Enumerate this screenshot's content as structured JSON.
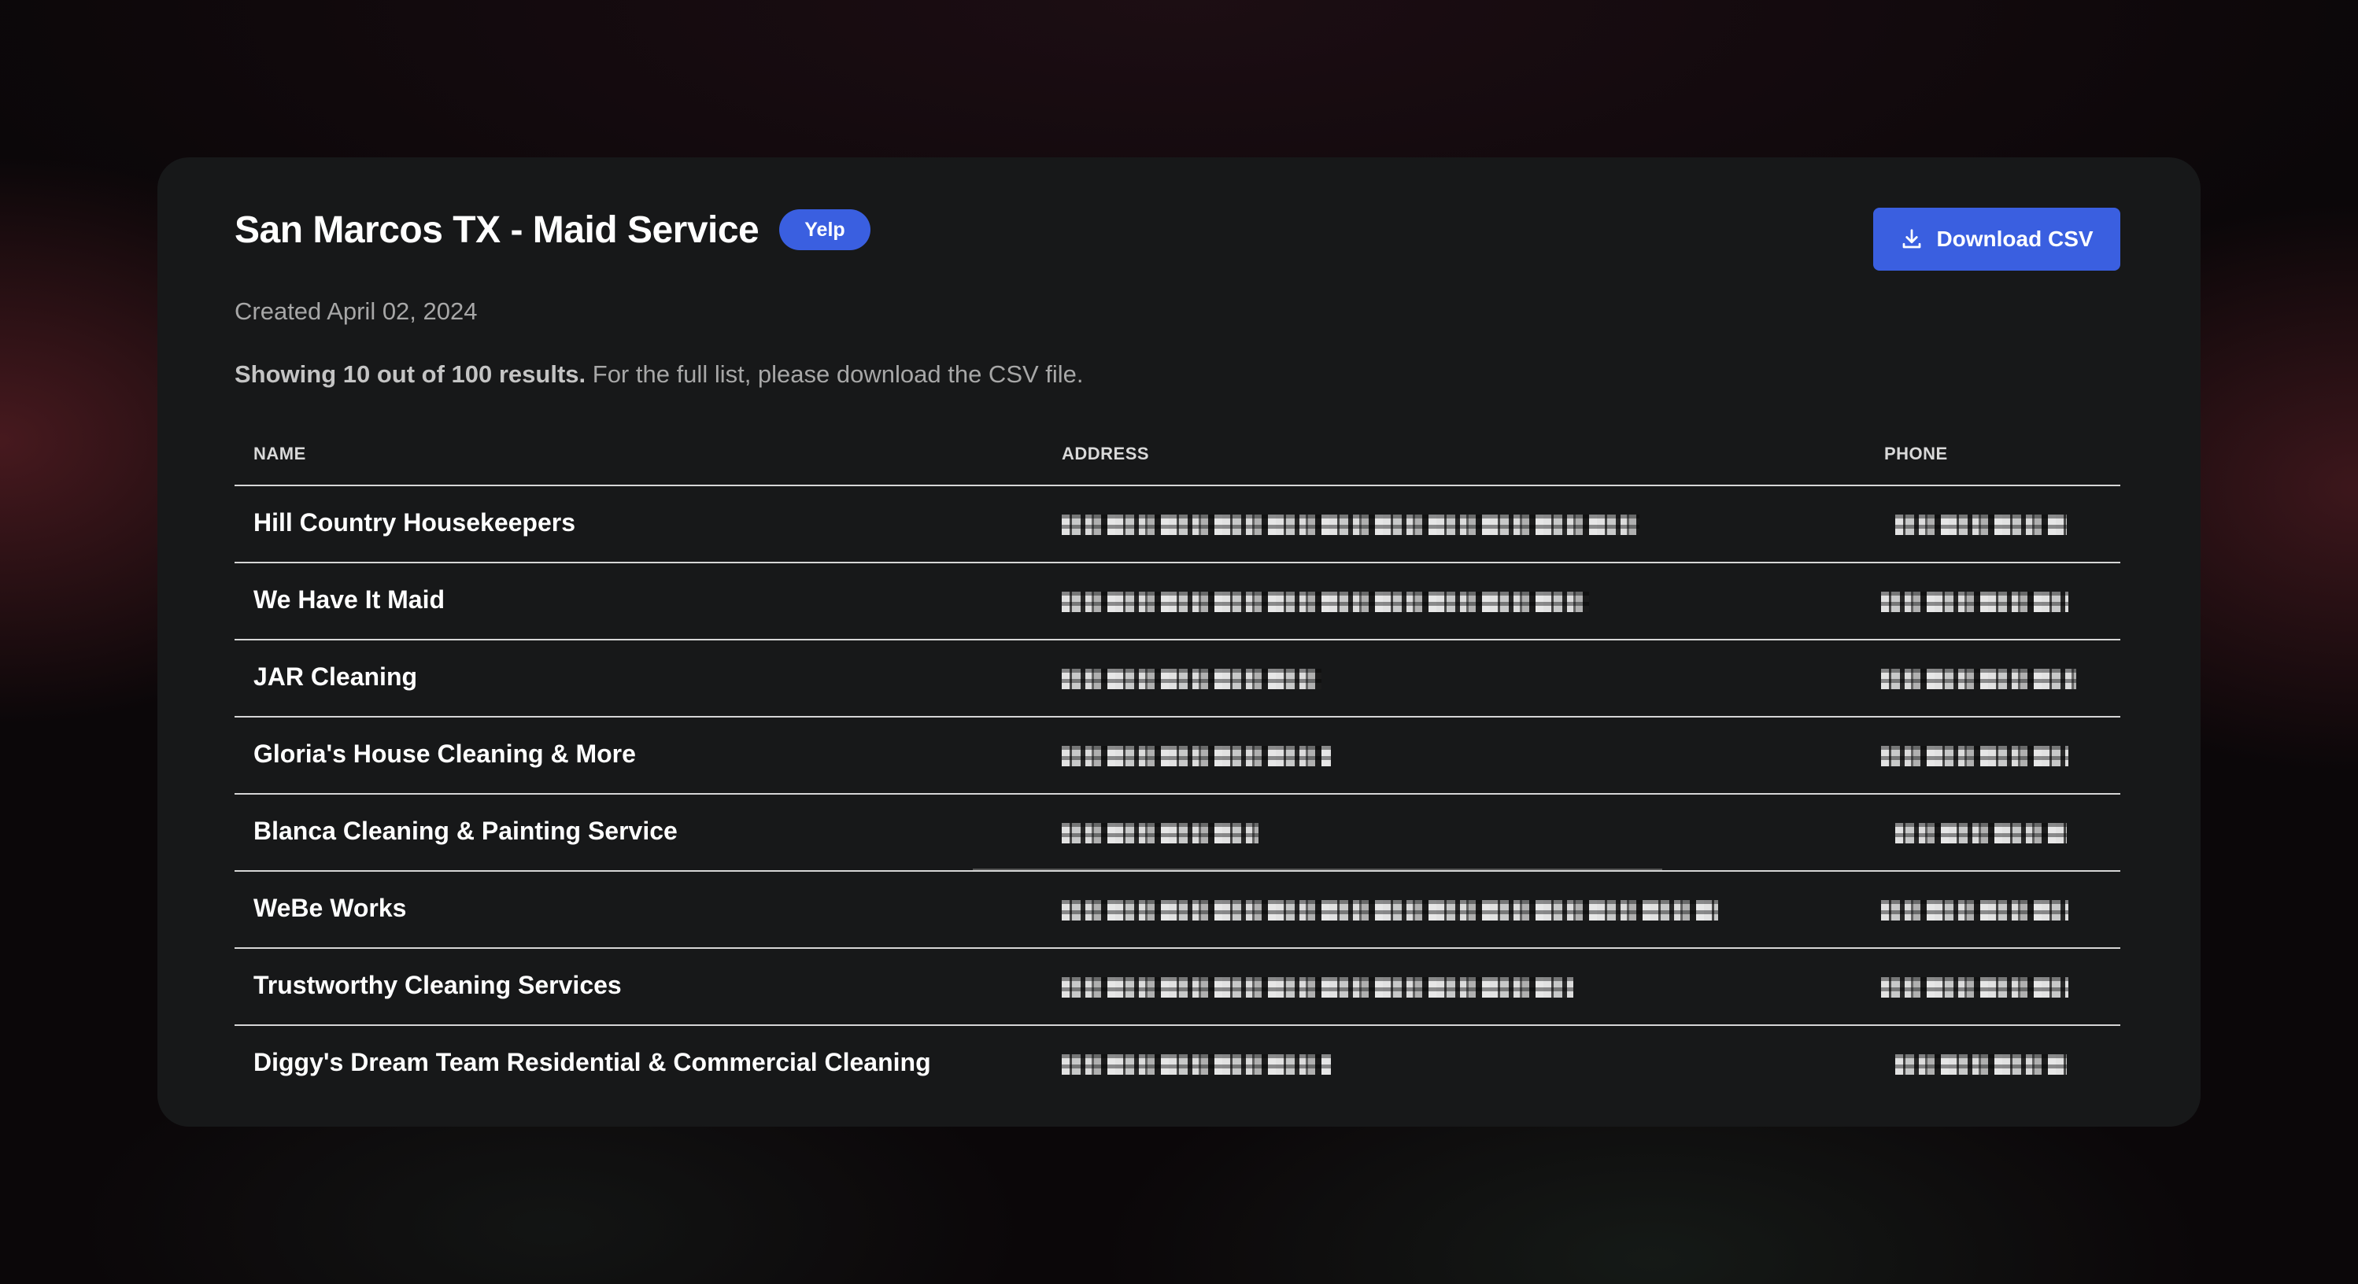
{
  "card": {
    "title": "San Marcos TX - Maid Service",
    "badge": "Yelp",
    "created": "Created April 02, 2024",
    "showing_strong": "Showing 10 out of 100 results.",
    "showing_rest": " For the full list, please download the CSV file.",
    "download_label": "Download CSV"
  },
  "table": {
    "headers": {
      "name": "NAME",
      "address": "ADDRESS",
      "phone": "PHONE"
    },
    "rows": [
      {
        "name": "Hill Country Housekeepers"
      },
      {
        "name": "We Have It Maid"
      },
      {
        "name": "JAR Cleaning"
      },
      {
        "name": "Gloria's House Cleaning & More"
      },
      {
        "name": "Blanca Cleaning & Painting Service"
      },
      {
        "name": "WeBe Works"
      },
      {
        "name": "Trustworthy Cleaning Services"
      },
      {
        "name": "Diggy's Dream Team Residential & Commercial Cleaning"
      }
    ]
  },
  "colors": {
    "accent": "#3a5fe0",
    "card_bg": "#171819",
    "page_bg": "#0b0709"
  },
  "icons": {
    "download": "download-icon"
  }
}
